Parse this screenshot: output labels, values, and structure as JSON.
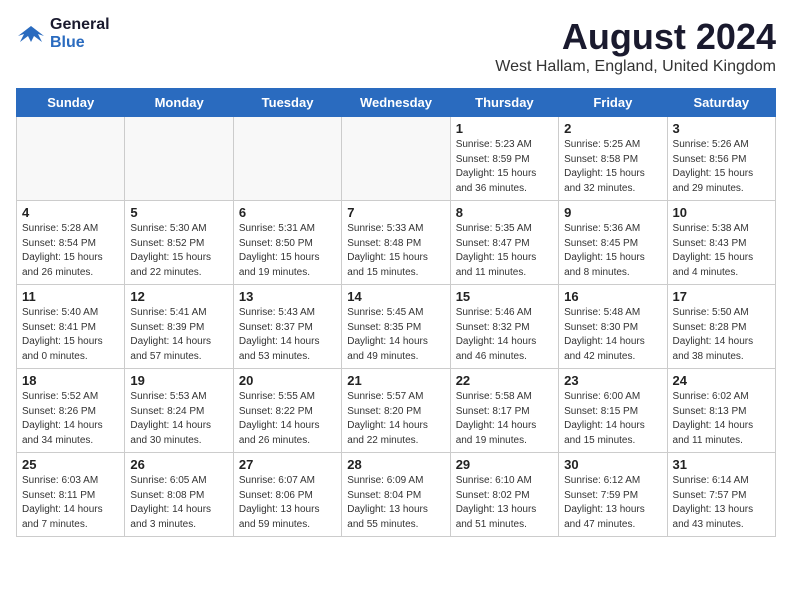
{
  "header": {
    "logo_line1": "General",
    "logo_line2": "Blue",
    "month_year": "August 2024",
    "location": "West Hallam, England, United Kingdom"
  },
  "weekdays": [
    "Sunday",
    "Monday",
    "Tuesday",
    "Wednesday",
    "Thursday",
    "Friday",
    "Saturday"
  ],
  "weeks": [
    [
      {
        "num": "",
        "info": "",
        "empty": true
      },
      {
        "num": "",
        "info": "",
        "empty": true
      },
      {
        "num": "",
        "info": "",
        "empty": true
      },
      {
        "num": "",
        "info": "",
        "empty": true
      },
      {
        "num": "1",
        "info": "Sunrise: 5:23 AM\nSunset: 8:59 PM\nDaylight: 15 hours\nand 36 minutes.",
        "empty": false
      },
      {
        "num": "2",
        "info": "Sunrise: 5:25 AM\nSunset: 8:58 PM\nDaylight: 15 hours\nand 32 minutes.",
        "empty": false
      },
      {
        "num": "3",
        "info": "Sunrise: 5:26 AM\nSunset: 8:56 PM\nDaylight: 15 hours\nand 29 minutes.",
        "empty": false
      }
    ],
    [
      {
        "num": "4",
        "info": "Sunrise: 5:28 AM\nSunset: 8:54 PM\nDaylight: 15 hours\nand 26 minutes.",
        "empty": false
      },
      {
        "num": "5",
        "info": "Sunrise: 5:30 AM\nSunset: 8:52 PM\nDaylight: 15 hours\nand 22 minutes.",
        "empty": false
      },
      {
        "num": "6",
        "info": "Sunrise: 5:31 AM\nSunset: 8:50 PM\nDaylight: 15 hours\nand 19 minutes.",
        "empty": false
      },
      {
        "num": "7",
        "info": "Sunrise: 5:33 AM\nSunset: 8:48 PM\nDaylight: 15 hours\nand 15 minutes.",
        "empty": false
      },
      {
        "num": "8",
        "info": "Sunrise: 5:35 AM\nSunset: 8:47 PM\nDaylight: 15 hours\nand 11 minutes.",
        "empty": false
      },
      {
        "num": "9",
        "info": "Sunrise: 5:36 AM\nSunset: 8:45 PM\nDaylight: 15 hours\nand 8 minutes.",
        "empty": false
      },
      {
        "num": "10",
        "info": "Sunrise: 5:38 AM\nSunset: 8:43 PM\nDaylight: 15 hours\nand 4 minutes.",
        "empty": false
      }
    ],
    [
      {
        "num": "11",
        "info": "Sunrise: 5:40 AM\nSunset: 8:41 PM\nDaylight: 15 hours\nand 0 minutes.",
        "empty": false
      },
      {
        "num": "12",
        "info": "Sunrise: 5:41 AM\nSunset: 8:39 PM\nDaylight: 14 hours\nand 57 minutes.",
        "empty": false
      },
      {
        "num": "13",
        "info": "Sunrise: 5:43 AM\nSunset: 8:37 PM\nDaylight: 14 hours\nand 53 minutes.",
        "empty": false
      },
      {
        "num": "14",
        "info": "Sunrise: 5:45 AM\nSunset: 8:35 PM\nDaylight: 14 hours\nand 49 minutes.",
        "empty": false
      },
      {
        "num": "15",
        "info": "Sunrise: 5:46 AM\nSunset: 8:32 PM\nDaylight: 14 hours\nand 46 minutes.",
        "empty": false
      },
      {
        "num": "16",
        "info": "Sunrise: 5:48 AM\nSunset: 8:30 PM\nDaylight: 14 hours\nand 42 minutes.",
        "empty": false
      },
      {
        "num": "17",
        "info": "Sunrise: 5:50 AM\nSunset: 8:28 PM\nDaylight: 14 hours\nand 38 minutes.",
        "empty": false
      }
    ],
    [
      {
        "num": "18",
        "info": "Sunrise: 5:52 AM\nSunset: 8:26 PM\nDaylight: 14 hours\nand 34 minutes.",
        "empty": false
      },
      {
        "num": "19",
        "info": "Sunrise: 5:53 AM\nSunset: 8:24 PM\nDaylight: 14 hours\nand 30 minutes.",
        "empty": false
      },
      {
        "num": "20",
        "info": "Sunrise: 5:55 AM\nSunset: 8:22 PM\nDaylight: 14 hours\nand 26 minutes.",
        "empty": false
      },
      {
        "num": "21",
        "info": "Sunrise: 5:57 AM\nSunset: 8:20 PM\nDaylight: 14 hours\nand 22 minutes.",
        "empty": false
      },
      {
        "num": "22",
        "info": "Sunrise: 5:58 AM\nSunset: 8:17 PM\nDaylight: 14 hours\nand 19 minutes.",
        "empty": false
      },
      {
        "num": "23",
        "info": "Sunrise: 6:00 AM\nSunset: 8:15 PM\nDaylight: 14 hours\nand 15 minutes.",
        "empty": false
      },
      {
        "num": "24",
        "info": "Sunrise: 6:02 AM\nSunset: 8:13 PM\nDaylight: 14 hours\nand 11 minutes.",
        "empty": false
      }
    ],
    [
      {
        "num": "25",
        "info": "Sunrise: 6:03 AM\nSunset: 8:11 PM\nDaylight: 14 hours\nand 7 minutes.",
        "empty": false
      },
      {
        "num": "26",
        "info": "Sunrise: 6:05 AM\nSunset: 8:08 PM\nDaylight: 14 hours\nand 3 minutes.",
        "empty": false
      },
      {
        "num": "27",
        "info": "Sunrise: 6:07 AM\nSunset: 8:06 PM\nDaylight: 13 hours\nand 59 minutes.",
        "empty": false
      },
      {
        "num": "28",
        "info": "Sunrise: 6:09 AM\nSunset: 8:04 PM\nDaylight: 13 hours\nand 55 minutes.",
        "empty": false
      },
      {
        "num": "29",
        "info": "Sunrise: 6:10 AM\nSunset: 8:02 PM\nDaylight: 13 hours\nand 51 minutes.",
        "empty": false
      },
      {
        "num": "30",
        "info": "Sunrise: 6:12 AM\nSunset: 7:59 PM\nDaylight: 13 hours\nand 47 minutes.",
        "empty": false
      },
      {
        "num": "31",
        "info": "Sunrise: 6:14 AM\nSunset: 7:57 PM\nDaylight: 13 hours\nand 43 minutes.",
        "empty": false
      }
    ]
  ]
}
